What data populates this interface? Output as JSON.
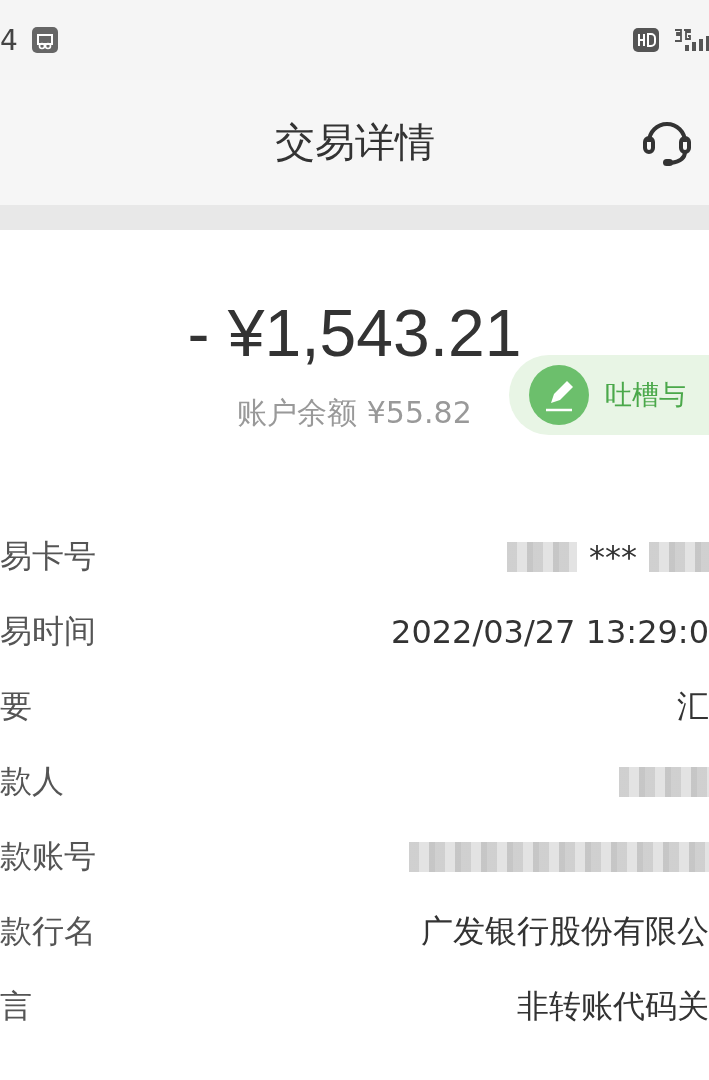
{
  "status_bar": {
    "time": "4"
  },
  "header": {
    "title": "交易详情"
  },
  "amount": "- ¥1,543.21",
  "balance": "账户余额 ¥55.82",
  "feedback": {
    "label": "吐槽与"
  },
  "details": [
    {
      "label": "易卡号",
      "kind": "masked",
      "value": "***"
    },
    {
      "label": "易时间",
      "kind": "text",
      "value": "2022/03/27 13:29:0"
    },
    {
      "label": "要",
      "kind": "text",
      "value": "汇"
    },
    {
      "label": "款人",
      "kind": "blurred"
    },
    {
      "label": "款账号",
      "kind": "blurred"
    },
    {
      "label": "款行名",
      "kind": "text",
      "value": "广发银行股份有限公"
    },
    {
      "label": "言",
      "kind": "text",
      "value": "非转账代码关"
    }
  ]
}
